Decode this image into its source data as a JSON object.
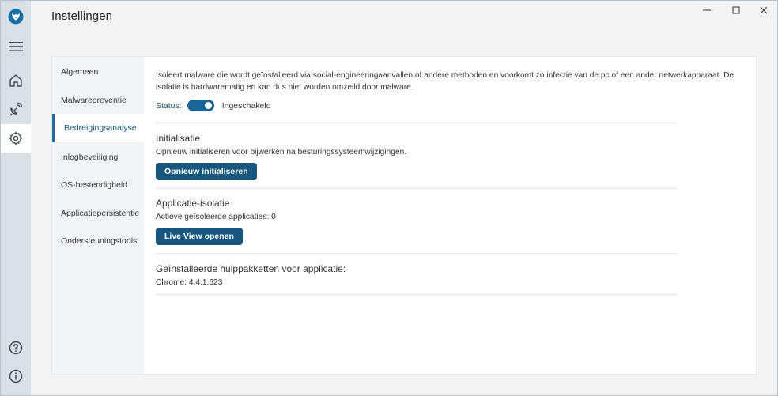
{
  "window": {
    "title": "Instellingen"
  },
  "rail": {
    "items": [
      {
        "icon": "fox-logo-icon"
      },
      {
        "icon": "hamburger-menu-icon"
      },
      {
        "icon": "home-icon"
      },
      {
        "icon": "satellite-dish-icon"
      },
      {
        "icon": "gear-icon",
        "active": true
      },
      {
        "icon": "help-icon"
      },
      {
        "icon": "info-icon"
      }
    ]
  },
  "subnav": {
    "items": [
      {
        "label": "Algemeen"
      },
      {
        "label": "Malwarepreventie"
      },
      {
        "label": "Bedreigingsanalyse",
        "active": true
      },
      {
        "label": "Inlogbeveiliging"
      },
      {
        "label": "OS-bestendigheid"
      },
      {
        "label": "Applicatiepersistentie"
      },
      {
        "label": "Ondersteuningstools"
      }
    ]
  },
  "main": {
    "description": "Isoleert malware die wordt geïnstalleerd via social-engineeringaanvallen of andere methoden en voorkomt zo infectie van de pc of een ander netwerkapparaat. De isolatie is hardwarematig en kan dus niet worden omzeild door malware.",
    "status_label": "Status:",
    "status_value": "Ingeschakeld",
    "initialisatie": {
      "title": "Initialisatie",
      "text": "Opnieuw initialiseren voor bijwerken na besturingssysteemwijzigingen.",
      "button": "Opnieuw initialiseren"
    },
    "isolatie": {
      "title": "Applicatie-isolatie",
      "text": "Actieve geïsoleerde applicaties: 0",
      "button": "Live View openen"
    },
    "hulppakketten": {
      "title": "Geïnstalleerde hulppakketten voor applicatie:",
      "text": "Chrome: 4.4.1.623"
    }
  },
  "colors": {
    "accent": "#17577f",
    "toggle_on": "#1a6696",
    "rail_bg": "#d9e0e6"
  }
}
